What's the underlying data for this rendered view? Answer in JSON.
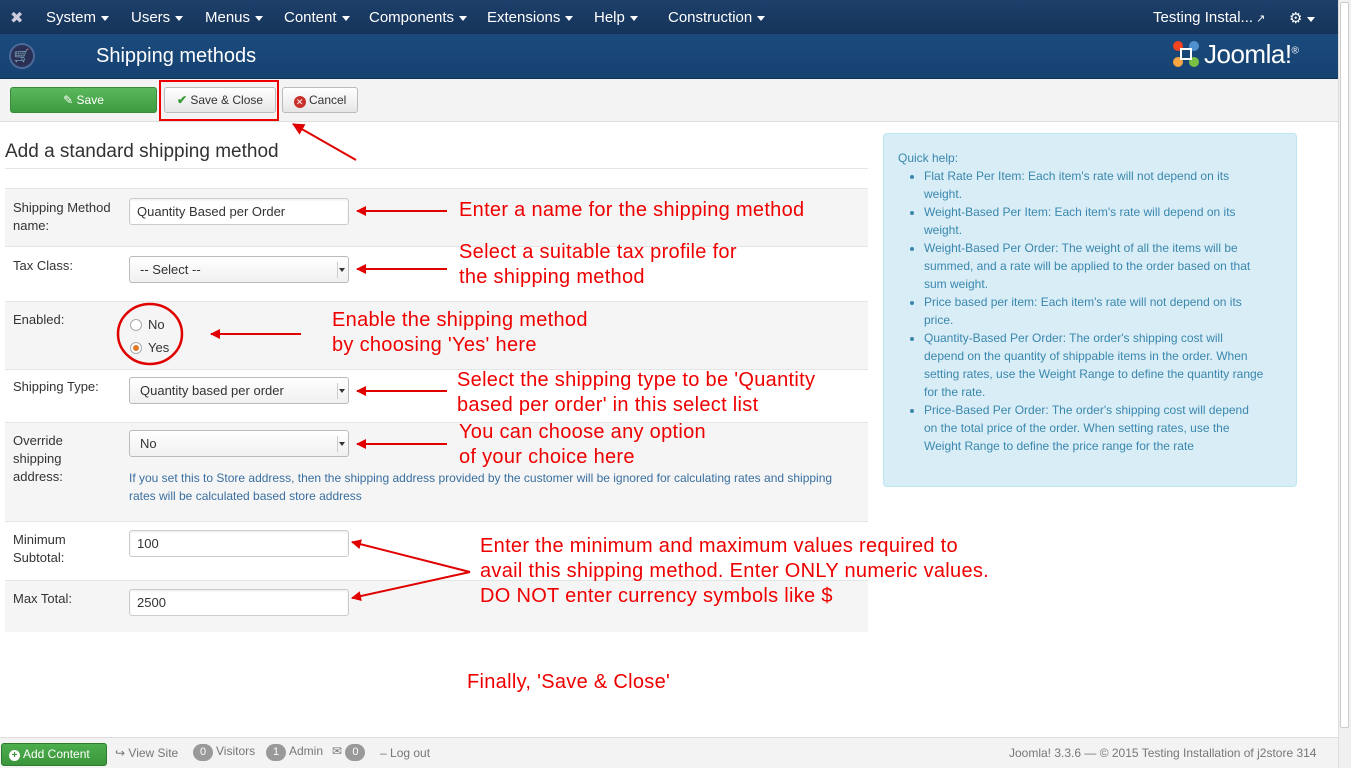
{
  "navbar": {
    "menu": [
      "System",
      "Users",
      "Menus",
      "Content",
      "Components",
      "Extensions",
      "Help",
      "Construction"
    ],
    "site_link": "Testing Instal..."
  },
  "header": {
    "title": "Shipping methods",
    "logo_text": "Joomla!",
    "logo_mark": "®"
  },
  "toolbar": {
    "save_label": "Save",
    "save_close_label": "Save & Close",
    "cancel_label": "Cancel"
  },
  "form": {
    "heading": "Add a standard shipping method",
    "name_label": "Shipping Method name:",
    "name_value": "Quantity Based per Order",
    "tax_label": "Tax Class:",
    "tax_value": "-- Select --",
    "enabled_label": "Enabled:",
    "enabled_options": [
      "No",
      "Yes"
    ],
    "enabled_selected": "Yes",
    "type_label": "Shipping Type:",
    "type_value": "Quantity based per order",
    "override_label": "Override shipping address:",
    "override_value": "No",
    "override_help": "If you set this to Store address, then the shipping address provided by the customer will be ignored for calculating rates and shipping rates will be calculated based store address",
    "min_label": "Minimum Subtotal:",
    "min_value": "100",
    "max_label": "Max Total:",
    "max_value": "2500"
  },
  "quick_help": {
    "title": "Quick help:",
    "items": [
      "Flat Rate Per Item: Each item's rate will not depend on its weight.",
      "Weight-Based Per Item: Each item's rate will depend on its weight.",
      "Weight-Based Per Order: The weight of all the items will be summed, and a rate will be applied to the order based on that sum weight.",
      "Price based per item: Each item's rate will not depend on its price.",
      "Quantity-Based Per Order: The order's shipping cost will depend on the quantity of shippable items in the order. When setting rates, use the Weight Range to define the quantity range for the rate.",
      "Price-Based Per Order: The order's shipping cost will depend on the total price of the order. When setting rates, use the Weight Range to define the price range for the rate"
    ]
  },
  "annotations": {
    "name": "Enter a name for the shipping method",
    "tax_1": "Select a suitable tax profile for",
    "tax_2": "the shipping method",
    "enabled_1": "Enable the shipping method",
    "enabled_2": "by choosing 'Yes' here",
    "type_1": "Select the shipping type to be 'Quantity",
    "type_2": "based per order' in this select list",
    "override_1": "You can choose any option",
    "override_2": "of your choice here",
    "minmax_1": "Enter the minimum and maximum values required to",
    "minmax_2": "avail this shipping method. Enter ONLY numeric values.",
    "minmax_3": "DO NOT enter currency symbols like $",
    "finally": "Finally, 'Save & Close'",
    "color": "#e00000"
  },
  "footer": {
    "add_content": "Add Content",
    "view_site": "View Site",
    "visitors_count": "0",
    "visitors_label": "Visitors",
    "admin_count": "1",
    "admin_label": "Admin",
    "messages_count": "0",
    "logout": "Log out",
    "copyright": "Joomla! 3.3.6 — © 2015 Testing Installation of j2store 314"
  }
}
